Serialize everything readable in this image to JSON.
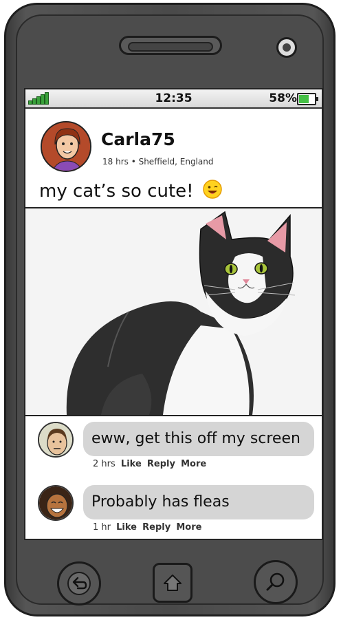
{
  "status": {
    "time": "12:35",
    "battery": "58%"
  },
  "post": {
    "username": "Carla75",
    "meta": "18 hrs • Sheffield, England",
    "text": "my cat’s so cute!"
  },
  "comments": [
    {
      "text": "eww, get this off my screen",
      "time": "2 hrs",
      "like": "Like",
      "reply": "Reply",
      "more": "More"
    },
    {
      "text": "Probably has fleas",
      "time": "1 hr",
      "like": "Like",
      "reply": "Reply",
      "more": "More"
    }
  ],
  "icons": {
    "back": "back-arrow-icon",
    "home": "home-icon",
    "search": "search-icon"
  },
  "colors": {
    "signal": "#39a13a",
    "battery": "#46c046",
    "bubble": "#d5d5d5"
  }
}
